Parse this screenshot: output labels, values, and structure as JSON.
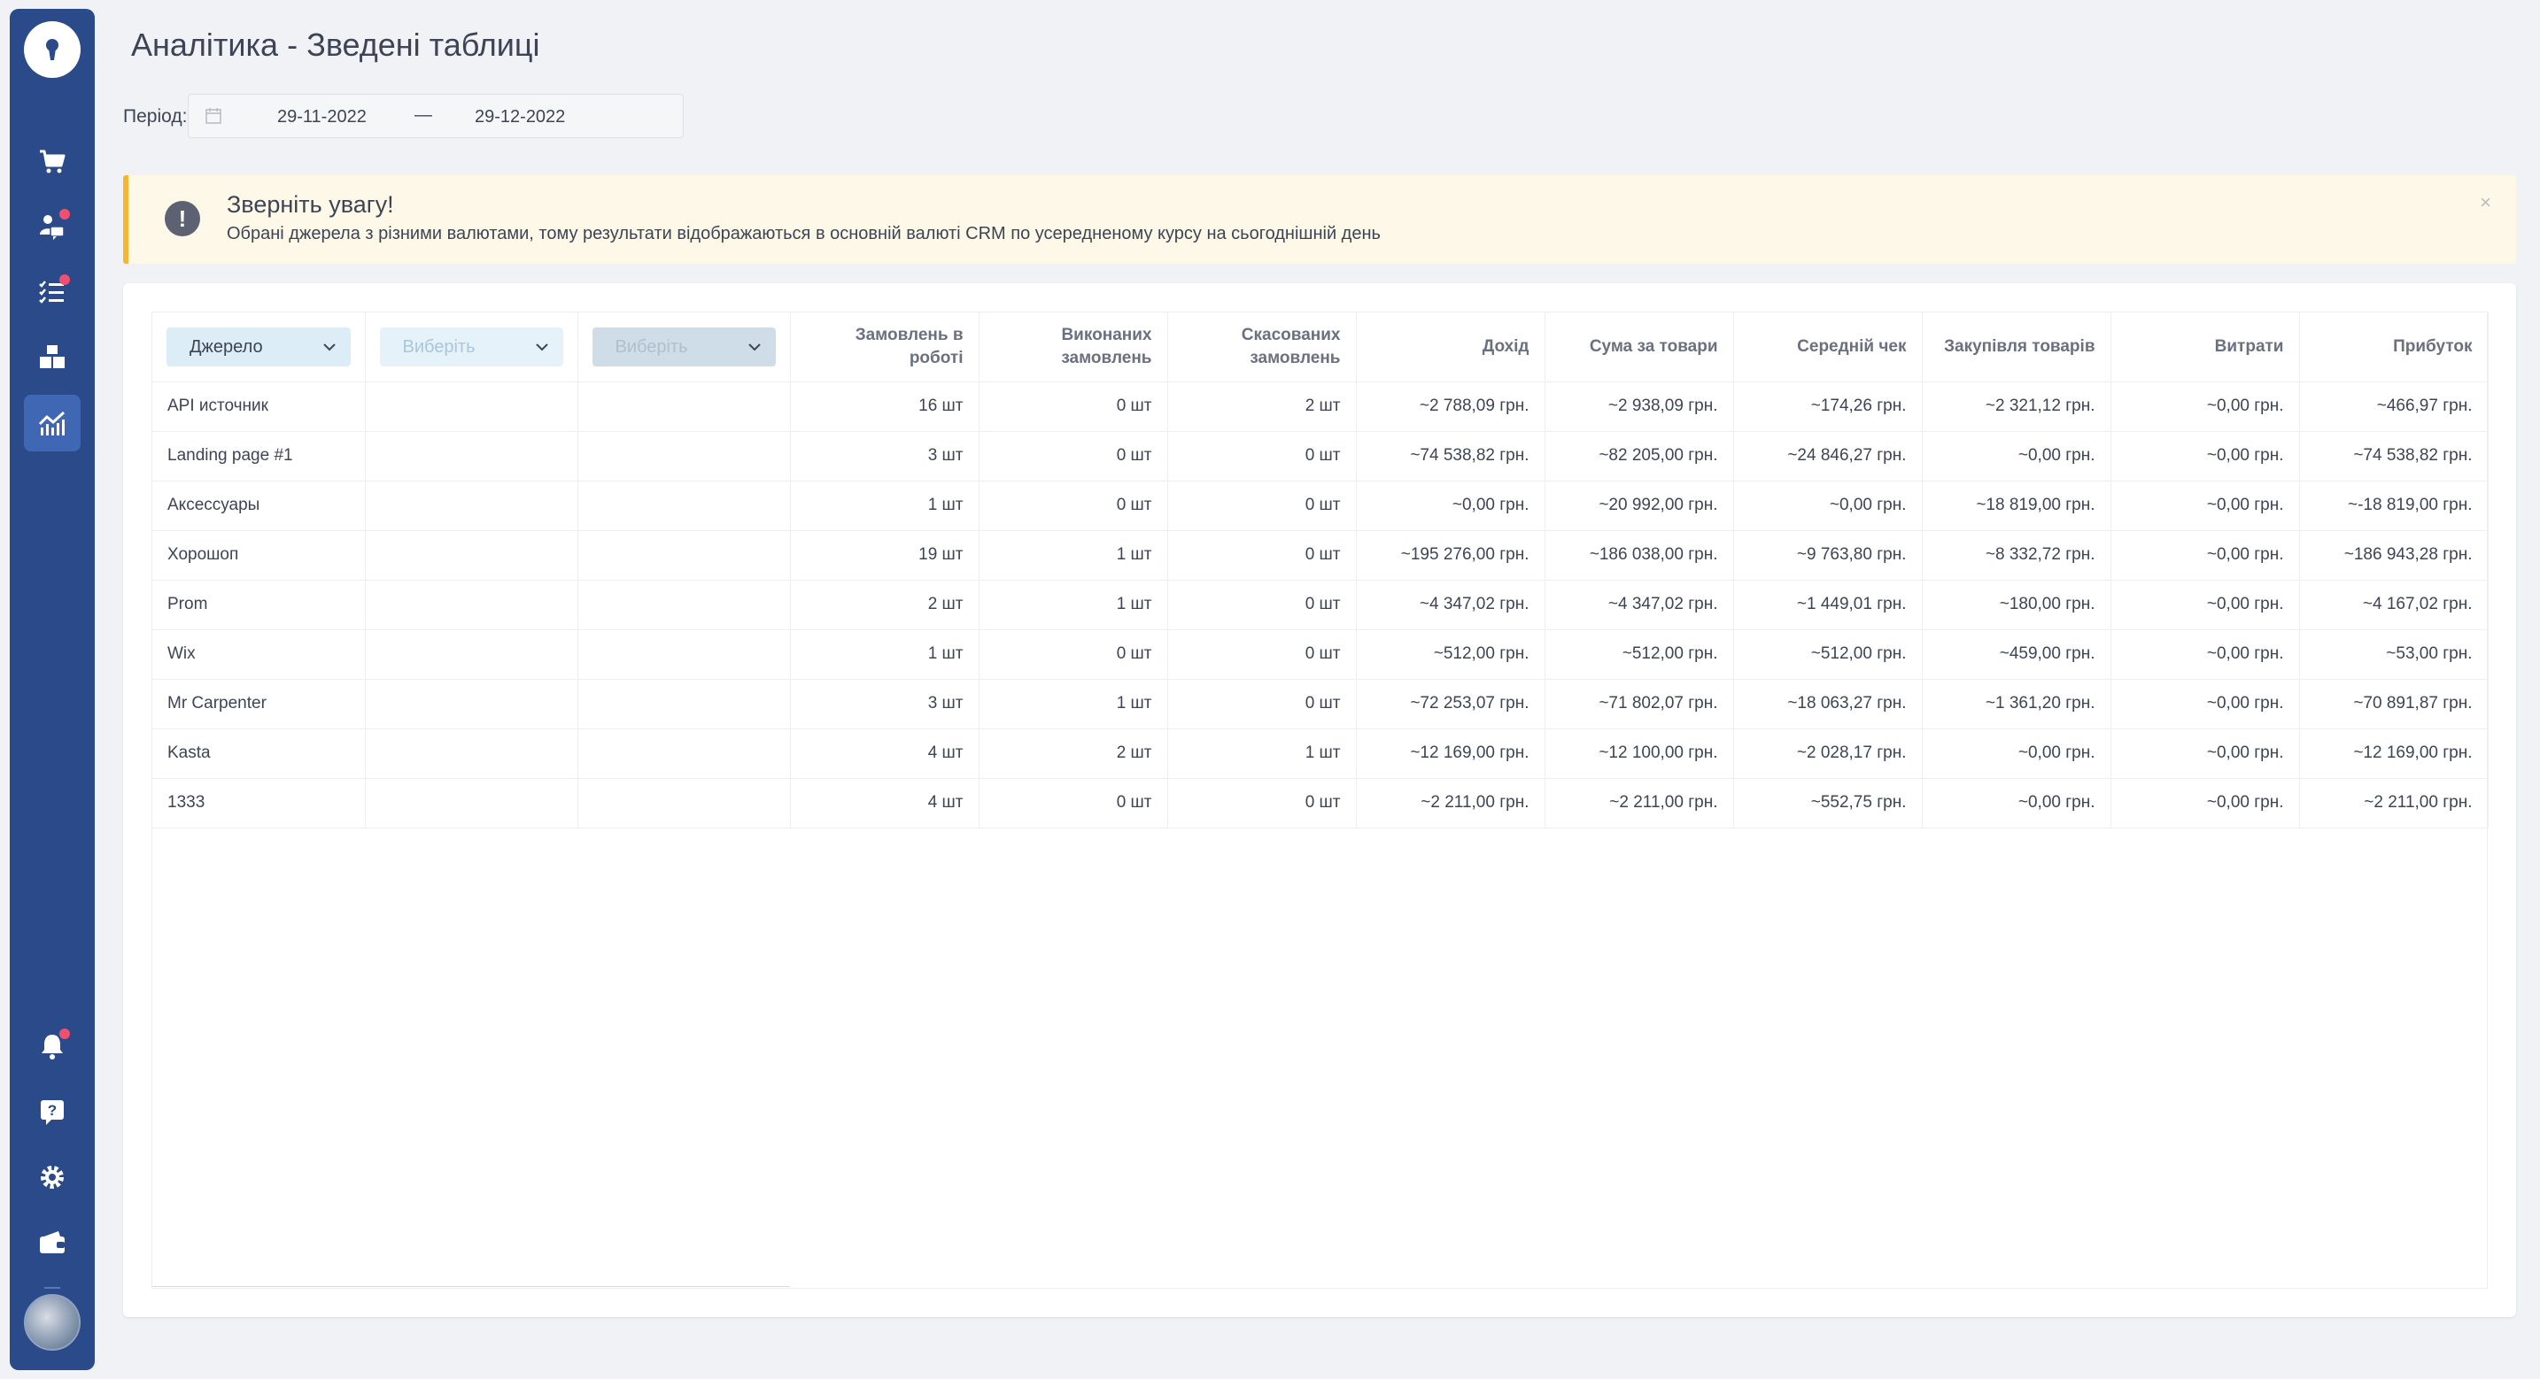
{
  "page": {
    "title": "Аналітика - Зведені таблиці"
  },
  "period": {
    "label": "Період:",
    "from": "29-11-2022",
    "separator": "—",
    "to": "29-12-2022"
  },
  "alert": {
    "title": "Зверніть увагу!",
    "text": "Обрані джерела з різними валютами, тому результати відображаються в основній валюті CRM по усередненому курсу на сьогоднішній день",
    "close": "×",
    "icon": "!"
  },
  "filters": {
    "first": "Джерело",
    "second": "Виберіть",
    "third": "Виберіть"
  },
  "columns": [
    "Замовлень в роботі",
    "Виконаних замовлень",
    "Скасованих замовлень",
    "Дохід",
    "Сума за товари",
    "Середній чек",
    "Закупівля товарів",
    "Витрати",
    "Прибуток"
  ],
  "rows": [
    {
      "name": "API источник",
      "values": [
        "16 шт",
        "0 шт",
        "2 шт",
        "~2 788,09 грн.",
        "~2 938,09 грн.",
        "~174,26 грн.",
        "~2 321,12 грн.",
        "~0,00 грн.",
        "~466,97 грн."
      ]
    },
    {
      "name": "Landing page #1",
      "values": [
        "3 шт",
        "0 шт",
        "0 шт",
        "~74 538,82 грн.",
        "~82 205,00 грн.",
        "~24 846,27 грн.",
        "~0,00 грн.",
        "~0,00 грн.",
        "~74 538,82 грн."
      ]
    },
    {
      "name": "Аксессуары",
      "values": [
        "1 шт",
        "0 шт",
        "0 шт",
        "~0,00 грн.",
        "~20 992,00 грн.",
        "~0,00 грн.",
        "~18 819,00 грн.",
        "~0,00 грн.",
        "~-18 819,00 грн."
      ]
    },
    {
      "name": "Хорошоп",
      "values": [
        "19 шт",
        "1 шт",
        "0 шт",
        "~195 276,00 грн.",
        "~186 038,00 грн.",
        "~9 763,80 грн.",
        "~8 332,72 грн.",
        "~0,00 грн.",
        "~186 943,28 грн."
      ]
    },
    {
      "name": "Prom",
      "values": [
        "2 шт",
        "1 шт",
        "0 шт",
        "~4 347,02 грн.",
        "~4 347,02 грн.",
        "~1 449,01 грн.",
        "~180,00 грн.",
        "~0,00 грн.",
        "~4 167,02 грн."
      ]
    },
    {
      "name": "Wix",
      "values": [
        "1 шт",
        "0 шт",
        "0 шт",
        "~512,00 грн.",
        "~512,00 грн.",
        "~512,00 грн.",
        "~459,00 грн.",
        "~0,00 грн.",
        "~53,00 грн."
      ]
    },
    {
      "name": "Mr Carpenter",
      "values": [
        "3 шт",
        "1 шт",
        "0 шт",
        "~72 253,07 грн.",
        "~71 802,07 грн.",
        "~18 063,27 грн.",
        "~1 361,20 грн.",
        "~0,00 грн.",
        "~70 891,87 грн."
      ]
    },
    {
      "name": "Kasta",
      "values": [
        "4 шт",
        "2 шт",
        "1 шт",
        "~12 169,00 грн.",
        "~12 100,00 грн.",
        "~2 028,17 грн.",
        "~0,00 грн.",
        "~0,00 грн.",
        "~12 169,00 грн."
      ]
    },
    {
      "name": "1333",
      "values": [
        "4 шт",
        "0 шт",
        "0 шт",
        "~2 211,00 грн.",
        "~2 211,00 грн.",
        "~552,75 грн.",
        "~0,00 грн.",
        "~0,00 грн.",
        "~2 211,00 грн."
      ]
    }
  ],
  "sidebar": {
    "items": [
      {
        "icon": "cart-icon"
      },
      {
        "icon": "clients-chat-icon",
        "badge": true
      },
      {
        "icon": "task-list-icon",
        "badge": true
      },
      {
        "icon": "warehouse-boxes-icon"
      },
      {
        "icon": "analytics-chart-icon",
        "active": true
      },
      {
        "icon": "bell-icon",
        "badge": true
      },
      {
        "icon": "help-icon"
      },
      {
        "icon": "settings-gear-icon"
      },
      {
        "icon": "wallet-icon"
      }
    ]
  },
  "colors": {
    "sidebar": "#2a4a8a",
    "sidebar_active": "#4067b3",
    "badge": "#f0506e",
    "alert_bg": "#fef8e8",
    "alert_border": "#f5b731"
  }
}
